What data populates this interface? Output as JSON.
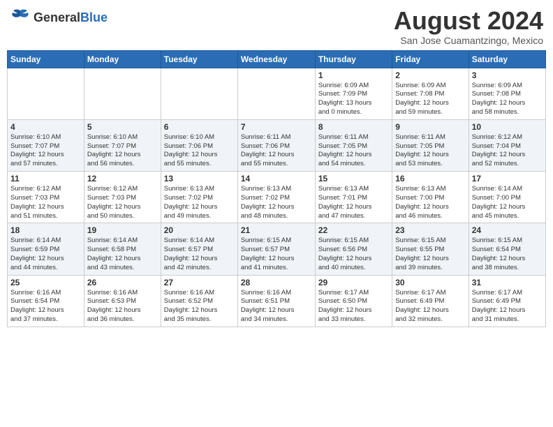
{
  "header": {
    "logo_general": "General",
    "logo_blue": "Blue",
    "month_year": "August 2024",
    "location": "San Jose Cuamantzingo, Mexico"
  },
  "days_of_week": [
    "Sunday",
    "Monday",
    "Tuesday",
    "Wednesday",
    "Thursday",
    "Friday",
    "Saturday"
  ],
  "weeks": [
    {
      "days": [
        {
          "num": "",
          "content": ""
        },
        {
          "num": "",
          "content": ""
        },
        {
          "num": "",
          "content": ""
        },
        {
          "num": "",
          "content": ""
        },
        {
          "num": "1",
          "content": "Sunrise: 6:09 AM\nSunset: 7:09 PM\nDaylight: 13 hours\nand 0 minutes."
        },
        {
          "num": "2",
          "content": "Sunrise: 6:09 AM\nSunset: 7:08 PM\nDaylight: 12 hours\nand 59 minutes."
        },
        {
          "num": "3",
          "content": "Sunrise: 6:09 AM\nSunset: 7:08 PM\nDaylight: 12 hours\nand 58 minutes."
        }
      ]
    },
    {
      "days": [
        {
          "num": "4",
          "content": "Sunrise: 6:10 AM\nSunset: 7:07 PM\nDaylight: 12 hours\nand 57 minutes."
        },
        {
          "num": "5",
          "content": "Sunrise: 6:10 AM\nSunset: 7:07 PM\nDaylight: 12 hours\nand 56 minutes."
        },
        {
          "num": "6",
          "content": "Sunrise: 6:10 AM\nSunset: 7:06 PM\nDaylight: 12 hours\nand 55 minutes."
        },
        {
          "num": "7",
          "content": "Sunrise: 6:11 AM\nSunset: 7:06 PM\nDaylight: 12 hours\nand 55 minutes."
        },
        {
          "num": "8",
          "content": "Sunrise: 6:11 AM\nSunset: 7:05 PM\nDaylight: 12 hours\nand 54 minutes."
        },
        {
          "num": "9",
          "content": "Sunrise: 6:11 AM\nSunset: 7:05 PM\nDaylight: 12 hours\nand 53 minutes."
        },
        {
          "num": "10",
          "content": "Sunrise: 6:12 AM\nSunset: 7:04 PM\nDaylight: 12 hours\nand 52 minutes."
        }
      ]
    },
    {
      "days": [
        {
          "num": "11",
          "content": "Sunrise: 6:12 AM\nSunset: 7:03 PM\nDaylight: 12 hours\nand 51 minutes."
        },
        {
          "num": "12",
          "content": "Sunrise: 6:12 AM\nSunset: 7:03 PM\nDaylight: 12 hours\nand 50 minutes."
        },
        {
          "num": "13",
          "content": "Sunrise: 6:13 AM\nSunset: 7:02 PM\nDaylight: 12 hours\nand 49 minutes."
        },
        {
          "num": "14",
          "content": "Sunrise: 6:13 AM\nSunset: 7:02 PM\nDaylight: 12 hours\nand 48 minutes."
        },
        {
          "num": "15",
          "content": "Sunrise: 6:13 AM\nSunset: 7:01 PM\nDaylight: 12 hours\nand 47 minutes."
        },
        {
          "num": "16",
          "content": "Sunrise: 6:13 AM\nSunset: 7:00 PM\nDaylight: 12 hours\nand 46 minutes."
        },
        {
          "num": "17",
          "content": "Sunrise: 6:14 AM\nSunset: 7:00 PM\nDaylight: 12 hours\nand 45 minutes."
        }
      ]
    },
    {
      "days": [
        {
          "num": "18",
          "content": "Sunrise: 6:14 AM\nSunset: 6:59 PM\nDaylight: 12 hours\nand 44 minutes."
        },
        {
          "num": "19",
          "content": "Sunrise: 6:14 AM\nSunset: 6:58 PM\nDaylight: 12 hours\nand 43 minutes."
        },
        {
          "num": "20",
          "content": "Sunrise: 6:14 AM\nSunset: 6:57 PM\nDaylight: 12 hours\nand 42 minutes."
        },
        {
          "num": "21",
          "content": "Sunrise: 6:15 AM\nSunset: 6:57 PM\nDaylight: 12 hours\nand 41 minutes."
        },
        {
          "num": "22",
          "content": "Sunrise: 6:15 AM\nSunset: 6:56 PM\nDaylight: 12 hours\nand 40 minutes."
        },
        {
          "num": "23",
          "content": "Sunrise: 6:15 AM\nSunset: 6:55 PM\nDaylight: 12 hours\nand 39 minutes."
        },
        {
          "num": "24",
          "content": "Sunrise: 6:15 AM\nSunset: 6:54 PM\nDaylight: 12 hours\nand 38 minutes."
        }
      ]
    },
    {
      "days": [
        {
          "num": "25",
          "content": "Sunrise: 6:16 AM\nSunset: 6:54 PM\nDaylight: 12 hours\nand 37 minutes."
        },
        {
          "num": "26",
          "content": "Sunrise: 6:16 AM\nSunset: 6:53 PM\nDaylight: 12 hours\nand 36 minutes."
        },
        {
          "num": "27",
          "content": "Sunrise: 6:16 AM\nSunset: 6:52 PM\nDaylight: 12 hours\nand 35 minutes."
        },
        {
          "num": "28",
          "content": "Sunrise: 6:16 AM\nSunset: 6:51 PM\nDaylight: 12 hours\nand 34 minutes."
        },
        {
          "num": "29",
          "content": "Sunrise: 6:17 AM\nSunset: 6:50 PM\nDaylight: 12 hours\nand 33 minutes."
        },
        {
          "num": "30",
          "content": "Sunrise: 6:17 AM\nSunset: 6:49 PM\nDaylight: 12 hours\nand 32 minutes."
        },
        {
          "num": "31",
          "content": "Sunrise: 6:17 AM\nSunset: 6:49 PM\nDaylight: 12 hours\nand 31 minutes."
        }
      ]
    }
  ]
}
